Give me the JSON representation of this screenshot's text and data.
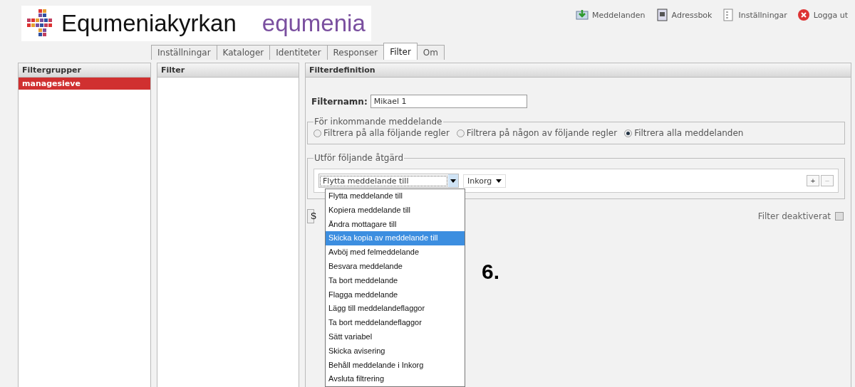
{
  "logo": {
    "name": "Equmeniakyrkan",
    "subname": "equmenia"
  },
  "top_links": [
    {
      "label": "Meddelanden",
      "kind": "mail"
    },
    {
      "label": "Adressbok",
      "kind": "book"
    },
    {
      "label": "Inställningar",
      "kind": "settings"
    },
    {
      "label": "Logga ut",
      "kind": "logout"
    }
  ],
  "tabs": [
    {
      "label": "Inställningar",
      "selected": false
    },
    {
      "label": "Kataloger",
      "selected": false
    },
    {
      "label": "Identiteter",
      "selected": false
    },
    {
      "label": "Responser",
      "selected": false
    },
    {
      "label": "Filter",
      "selected": true
    },
    {
      "label": "Om",
      "selected": false
    }
  ],
  "filter_groups": {
    "title": "Filtergrupper",
    "items": [
      {
        "label": "managesieve",
        "selected": true
      }
    ]
  },
  "filters": {
    "title": "Filter"
  },
  "definition": {
    "title": "Filterdefinition",
    "name_label": "Filternamn:",
    "name_value": "Mikael 1",
    "incoming": {
      "legend": "För inkommande meddelande",
      "options": [
        {
          "label": "Filtrera på alla följande regler",
          "selected": false
        },
        {
          "label": "Filtrera på någon av följande regler",
          "selected": false
        },
        {
          "label": "Filtrera alla meddelanden",
          "selected": true
        }
      ]
    },
    "actions": {
      "legend": "Utför följande åtgärd",
      "action_value": "Flytta meddelande till",
      "folder_value": "Inkorg",
      "add": "+",
      "remove": "−",
      "dropdown": [
        {
          "label": "Flytta meddelande till",
          "selected": false
        },
        {
          "label": "Kopiera meddelande till",
          "selected": false
        },
        {
          "label": "Ändra mottagare till",
          "selected": false
        },
        {
          "label": "Skicka kopia av meddelande till",
          "selected": true
        },
        {
          "label": "Avböj med felmeddelande",
          "selected": false
        },
        {
          "label": "Besvara meddelande",
          "selected": false
        },
        {
          "label": "Ta bort meddelande",
          "selected": false
        },
        {
          "label": "Flagga meddelande",
          "selected": false
        },
        {
          "label": "Lägg till meddelandeflaggor",
          "selected": false
        },
        {
          "label": "Ta bort meddelandeflaggor",
          "selected": false
        },
        {
          "label": "Sätt variabel",
          "selected": false
        },
        {
          "label": "Skicka avisering",
          "selected": false
        },
        {
          "label": "Behåll meddelande i Inkorg",
          "selected": false
        },
        {
          "label": "Avsluta filtrering",
          "selected": false
        }
      ]
    },
    "save_button": "S",
    "disabled_label": "Filter deaktiverat",
    "disabled_checked": false
  },
  "annotation": "6."
}
